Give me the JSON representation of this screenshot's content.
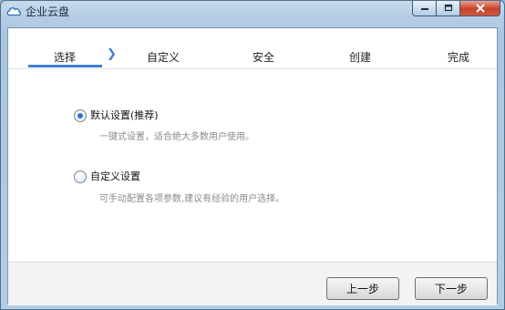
{
  "window": {
    "title": "企业云盘",
    "icon": "cloud-icon"
  },
  "steps": [
    {
      "label": "选择",
      "active": true
    },
    {
      "label": "自定义"
    },
    {
      "label": "安全"
    },
    {
      "label": "创建"
    },
    {
      "label": "完成"
    }
  ],
  "options": [
    {
      "label": "默认设置(推荐)",
      "description": "一键式设置，适合绝大多数用户使用。",
      "selected": true
    },
    {
      "label": "自定义设置",
      "description": "可手动配置各项参数,建议有经验的用户选择。",
      "selected": false
    }
  ],
  "buttons": {
    "prev": "上一步",
    "next": "下一步"
  },
  "colors": {
    "accent": "#3b7fd0",
    "close": "#c7432b"
  }
}
